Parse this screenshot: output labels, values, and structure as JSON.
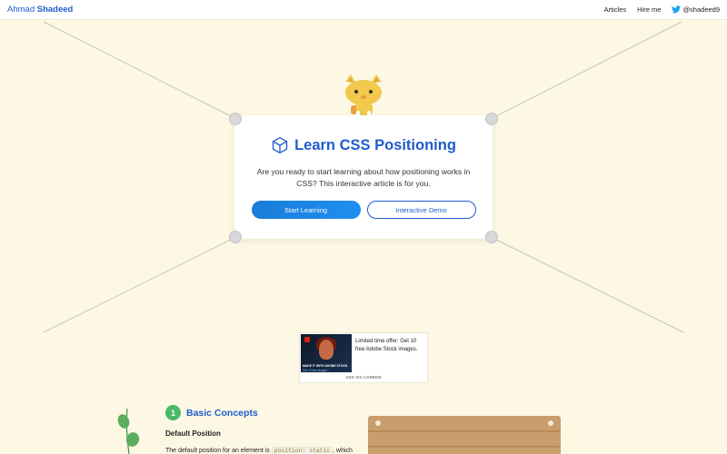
{
  "header": {
    "brand_first": "Ahmad",
    "brand_last": "Shadeed",
    "nav": {
      "articles": "Articles",
      "hire": "Hire me",
      "twitter": "@shadeed9"
    }
  },
  "hero": {
    "title": "Learn CSS Positioning",
    "description": "Are you ready to start learning about how positioning works in CSS? This interactive article is for you.",
    "primary_button": "Start Learning",
    "secondary_button": "Interactive Demo"
  },
  "ad": {
    "text": "Limited time offer: Get 10 free Adobe Stock images.",
    "via": "ADS VIA CARBON",
    "image_text": "MAKE IT WITH ADOBE STOCK.",
    "image_subtext": "Get 10 free images ›"
  },
  "section": {
    "number": "1",
    "title": "Basic Concepts",
    "subtitle": "Default Position",
    "text_before": "The default position for an element is",
    "code": "position: static",
    "text_after": ", which"
  },
  "colors": {
    "accent": "#1f5ccc",
    "background": "#fdf8e4",
    "step_badge": "#4bb86a",
    "twitter": "#1da1f2"
  },
  "icons": [
    "twitter-icon",
    "cube-icon",
    "cat-illustration",
    "plant-illustration",
    "wood-board-illustration"
  ]
}
